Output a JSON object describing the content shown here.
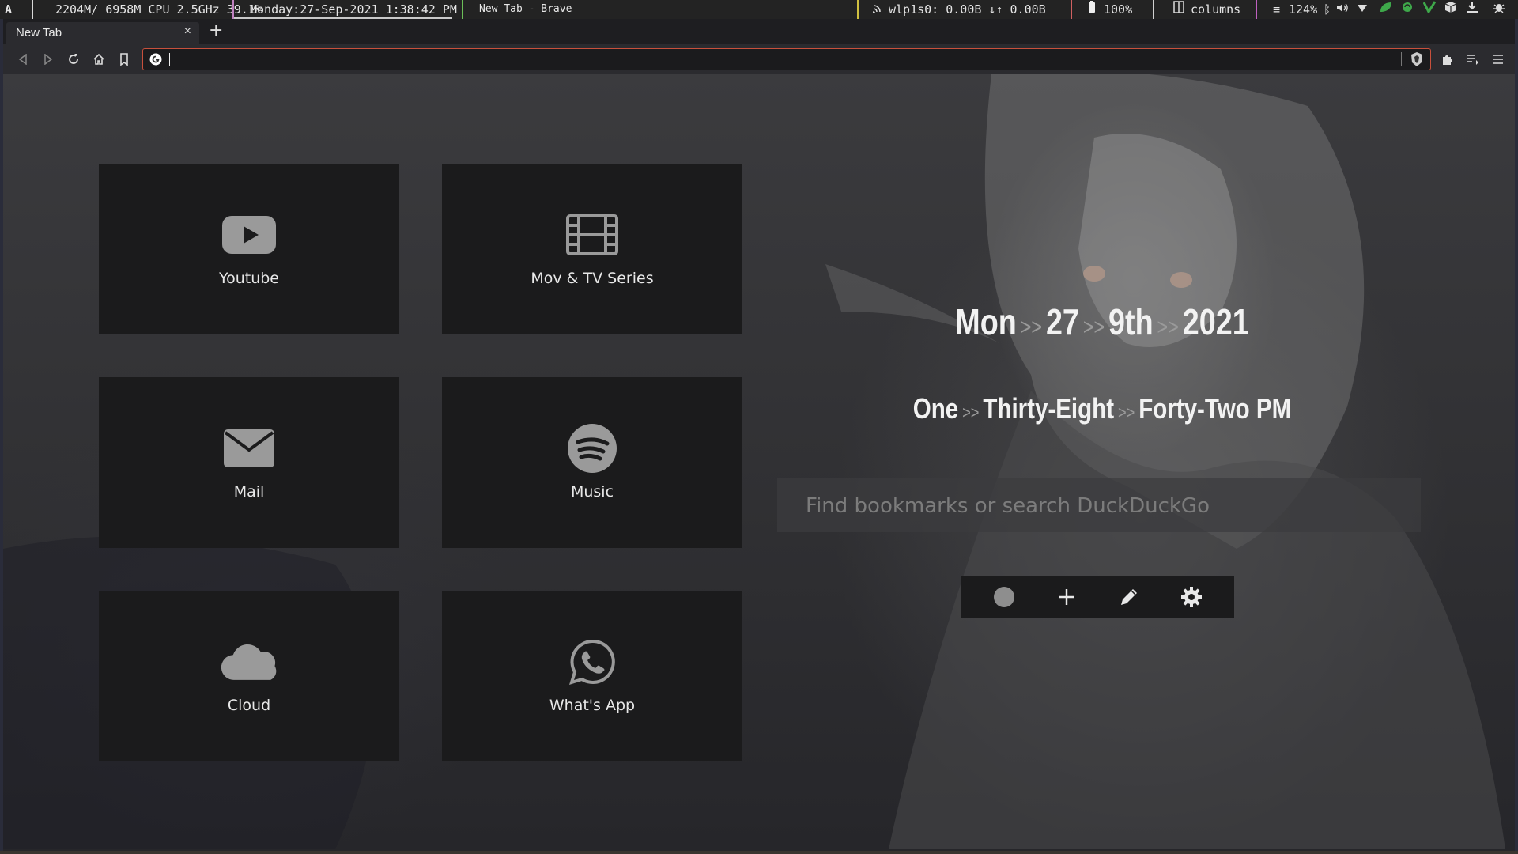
{
  "statusbar": {
    "launcher": "A",
    "sysinfo": "2204M/ 6958M CPU 2.5GHz 39.1%",
    "clock": "Monday:27-Sep-2021  1:38:42 PM",
    "window_title": "New Tab - Brave",
    "network": "wlp1s0:  0.00B ↓↑  0.00B",
    "battery": "100%",
    "layout": "columns",
    "volume": "124%"
  },
  "browser": {
    "tab_title": "New Tab",
    "tab_close": "×",
    "new_tab": "+",
    "url_value": ""
  },
  "tiles": [
    {
      "label": "Youtube",
      "icon": "youtube-icon"
    },
    {
      "label": "Mov & TV Series",
      "icon": "film-icon"
    },
    {
      "label": "Mail",
      "icon": "mail-icon"
    },
    {
      "label": "Music",
      "icon": "spotify-icon"
    },
    {
      "label": "Cloud",
      "icon": "cloud-icon"
    },
    {
      "label": "What's App",
      "icon": "whatsapp-icon"
    }
  ],
  "date": {
    "day": "Mon",
    "date": "27",
    "month": "9th",
    "year": "2021",
    "sep": ">>"
  },
  "time": {
    "hour": "One",
    "minute": "Thirty-Eight",
    "second": "Forty-Two PM",
    "sep": ">>"
  },
  "search": {
    "placeholder": "Find bookmarks or search DuckDuckGo",
    "value": ""
  },
  "colors": {
    "accent_red": "#c8503c",
    "tile_bg": "#1b1b1c",
    "statusbar_bg": "#232323"
  }
}
